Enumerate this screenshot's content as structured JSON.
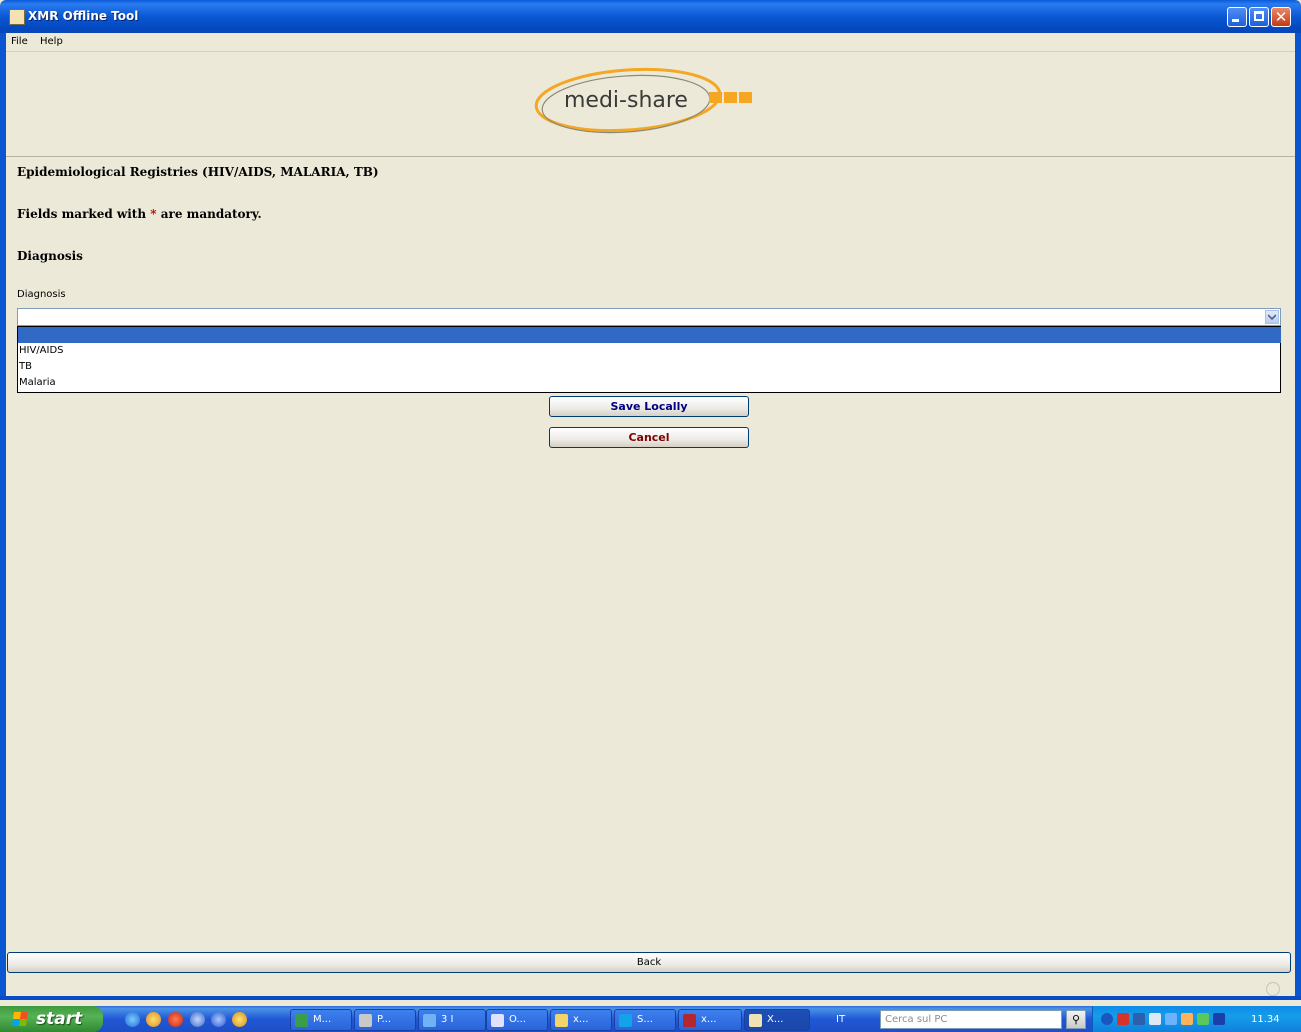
{
  "window": {
    "title": "XMR Offline Tool"
  },
  "menu": {
    "items": [
      "File",
      "Help"
    ]
  },
  "logo": {
    "text": "medi-share"
  },
  "form": {
    "heading": "Epidemiological Registries (HIV/AIDS, MALARIA, TB)",
    "mandatory_prefix": "Fields marked with",
    "mandatory_star": "*",
    "mandatory_suffix": "are mandatory.",
    "section": "Diagnosis",
    "diagnosis_label": "Diagnosis",
    "diagnosis_value": "",
    "diagnosis_options": [
      "",
      "HIV/AIDS",
      "TB",
      "Malaria"
    ],
    "selected_option_index": 0,
    "save_label": "Save Locally",
    "cancel_label": "Cancel"
  },
  "footer": {
    "back_label": "Back"
  },
  "taskbar": {
    "start_label": "start",
    "tasks": [
      "M...",
      "P...",
      "3 I",
      "O...",
      "x...",
      "S...",
      "x...",
      "X..."
    ],
    "language": "IT",
    "search_placeholder": "Cerca sul PC",
    "clock": "11.34"
  },
  "colors": {
    "accent": "#316ac5",
    "required": "#c00000",
    "logo_orange": "#f5a623"
  }
}
